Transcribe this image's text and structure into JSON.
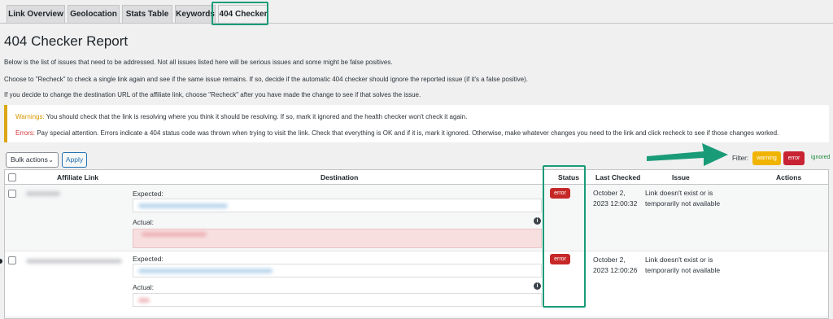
{
  "tabs": [
    {
      "label": "Link Overview"
    },
    {
      "label": "Geolocation"
    },
    {
      "label": "Stats Table"
    },
    {
      "label": "Keywords"
    },
    {
      "label": "404 Checker",
      "active": true
    }
  ],
  "page": {
    "title": "404 Checker Report",
    "paragraphs": [
      "Below is the list of issues that need to be addressed. Not all issues listed here will be serious issues and some might be false positives.",
      "Choose to \"Recheck\" to check a single link again and see if the same issue remains. If so, decide if the automatic 404 checker should ignore the reported issue (if it's a false positive).",
      "If you decide to change the destination URL of the affiliate link, choose \"Recheck\" after you have made the change to see if that solves the issue."
    ]
  },
  "notice": {
    "warnings_label": "Warnings:",
    "warnings_text": " You should check that the link is resolving where you think it should be resolving. If so, mark it ignored and the health checker won't check it again.",
    "errors_label": "Errors:",
    "errors_text": " Pay special attention. Errors indicate a 404 status code was thrown when trying to visit the link. Check that everything is OK and if it is, mark it ignored. Otherwise, make whatever changes you need to the link and click recheck to see if those changes worked."
  },
  "toolbar": {
    "bulk_label": "Bulk actions",
    "apply_label": "Apply",
    "filter_label": "Filter:",
    "filter_warning": "warning",
    "filter_error": "error",
    "filter_ignored": "ignored"
  },
  "table": {
    "headers": {
      "affiliate_link": "Affiliate Link",
      "destination": "Destination",
      "status": "Status",
      "last_checked": "Last Checked",
      "issue": "Issue",
      "actions": "Actions"
    },
    "rows": [
      {
        "expected_label": "Expected:",
        "actual_label": "Actual:",
        "status": "error",
        "last_checked_date": "October 2,",
        "last_checked_time": "2023 12:00:32",
        "issue_line1": "Link doesn't exist or is",
        "issue_line2": "temporarily not available"
      },
      {
        "expected_label": "Expected:",
        "actual_label": "Actual:",
        "status": "error",
        "last_checked_date": "October 2,",
        "last_checked_time": "2023 12:00:26",
        "issue_line1": "Link doesn't exist or is",
        "issue_line2": "temporarily not available"
      }
    ]
  },
  "colors": {
    "highlight": "#1a9b78",
    "warning": "#f0b400",
    "error": "#c62828",
    "ignored": "#1f8a3e"
  }
}
